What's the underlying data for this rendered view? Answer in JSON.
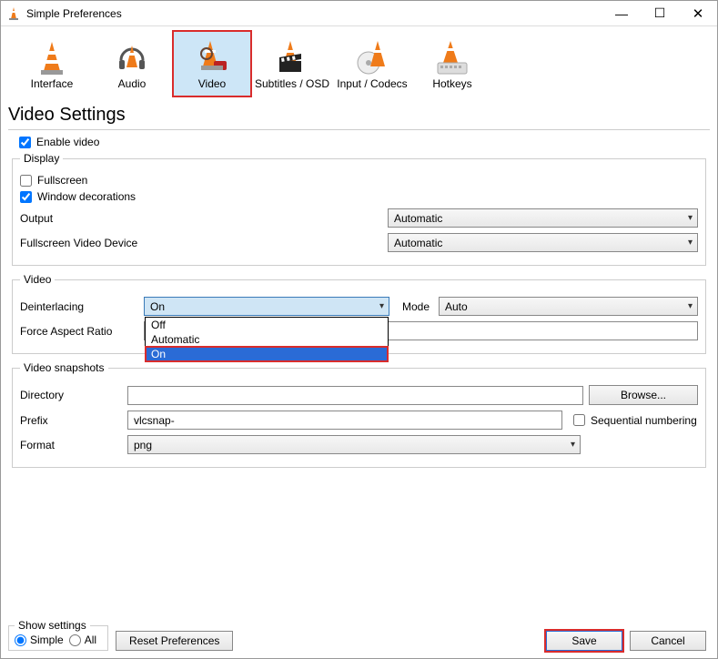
{
  "window": {
    "title": "Simple Preferences"
  },
  "tabs": {
    "interface": "Interface",
    "audio": "Audio",
    "video": "Video",
    "subtitles": "Subtitles / OSD",
    "input": "Input / Codecs",
    "hotkeys": "Hotkeys"
  },
  "heading": "Video Settings",
  "enable_video": {
    "label": "Enable video",
    "checked": true
  },
  "display": {
    "legend": "Display",
    "fullscreen": {
      "label": "Fullscreen",
      "checked": false
    },
    "window_decorations": {
      "label": "Window decorations",
      "checked": true
    },
    "output_label": "Output",
    "output_value": "Automatic",
    "device_label": "Fullscreen Video Device",
    "device_value": "Automatic"
  },
  "video": {
    "legend": "Video",
    "deinterlacing_label": "Deinterlacing",
    "deinterlacing_value": "On",
    "deinterlacing_options": {
      "off": "Off",
      "automatic": "Automatic",
      "on": "On"
    },
    "mode_label": "Mode",
    "mode_value": "Auto",
    "aspect_label": "Force Aspect Ratio",
    "aspect_value": ""
  },
  "snapshots": {
    "legend": "Video snapshots",
    "directory_label": "Directory",
    "directory_value": "",
    "browse": "Browse...",
    "prefix_label": "Prefix",
    "prefix_value": "vlcsnap-",
    "sequential": {
      "label": "Sequential numbering",
      "checked": false
    },
    "format_label": "Format",
    "format_value": "png"
  },
  "bottom": {
    "show_settings": "Show settings",
    "simple": "Simple",
    "all": "All",
    "reset": "Reset Preferences",
    "save": "Save",
    "cancel": "Cancel"
  }
}
